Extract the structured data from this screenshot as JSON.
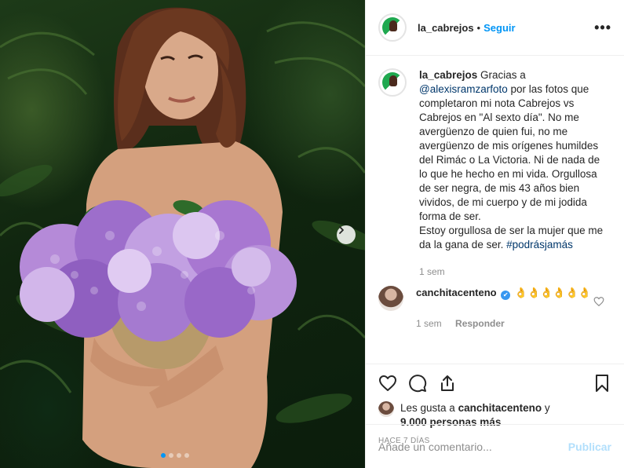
{
  "header": {
    "username": "la_cabrejos",
    "separator": "•",
    "follow_label": "Seguir",
    "more_label": "•••"
  },
  "caption": {
    "username": "la_cabrejos",
    "text_before_mention": " Gracias a ",
    "mention": "@alexisramzarfoto",
    "text_after_mention": " por las fotos que completaron mi nota Cabrejos vs Cabrejos en \"Al sexto día\". No me avergüenzo de quien fui, no me avergüenzo de mis orígenes humildes del Rimác o La Victoria. Ni de nada de lo que he hecho en mi vida. Orgullosa de ser negra, de mis 43 años bien vividos, de mi cuerpo y de mi jodida forma de ser.",
    "text_line2": "Estoy orgullosa de ser la mujer que me da la gana de ser. ",
    "hashtag": "#podrásjamás",
    "time": "1 sem"
  },
  "reply": {
    "username": "canchitacenteno",
    "verified_mark": "✔",
    "text": " 👌👌👌👌👌👌",
    "time": "1 sem",
    "reply_label": "Responder"
  },
  "likes": {
    "prefix": "Les gusta a ",
    "user": "canchitacenteno",
    "middle": " y ",
    "count": "9.000 personas más"
  },
  "posted_time": "HACE 7 DÍAS",
  "comment_box": {
    "placeholder": "Añade un comentario...",
    "publish_label": "Publicar"
  },
  "carousel": {
    "total_slides": 4,
    "active_slide": 1
  },
  "colors": {
    "accent": "#0095f6",
    "publish_disabled": "#b2dffc",
    "muted": "#8e8e8e"
  },
  "icons": [
    "heart-icon",
    "comment-icon",
    "share-icon",
    "bookmark-icon",
    "chevron-right-icon",
    "more-icon"
  ]
}
